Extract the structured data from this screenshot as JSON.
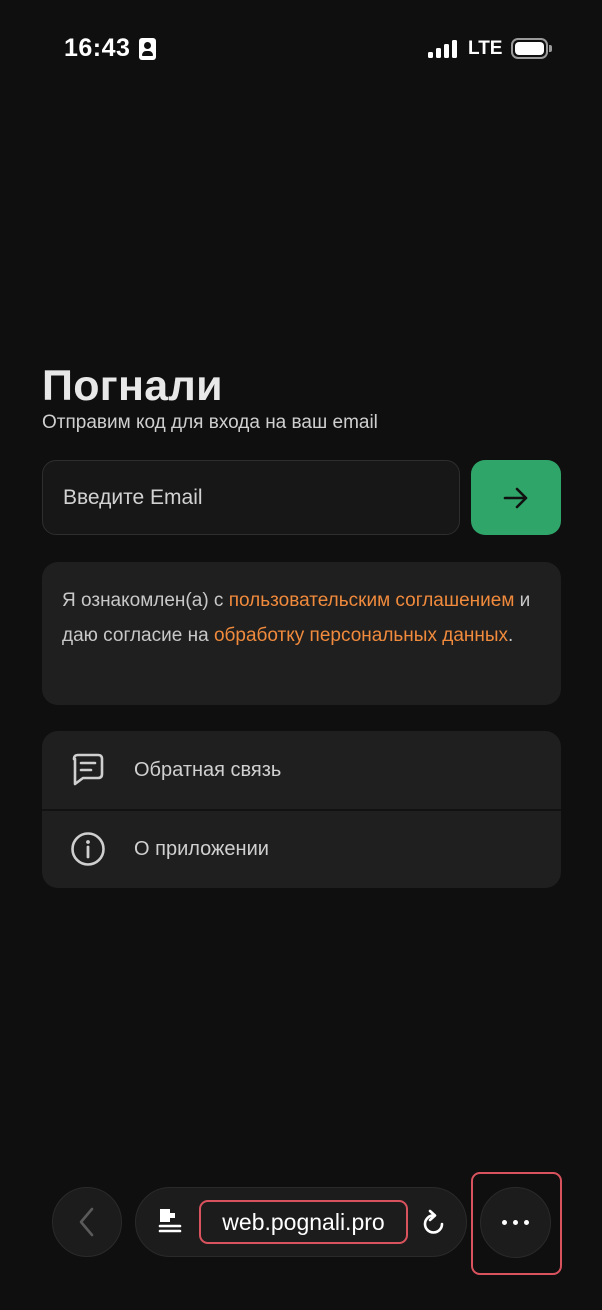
{
  "status_bar": {
    "time": "16:43",
    "network": "LTE",
    "icons": [
      "contact-card-icon",
      "signal-icon",
      "battery-icon"
    ]
  },
  "login": {
    "title": "Погнали",
    "subtitle": "Отправим код для входа на ваш email",
    "email_placeholder": "Введите Email",
    "submit_icon": "arrow-right-icon"
  },
  "consent": {
    "text_1": "Я ознакомлен(а) с ",
    "link_terms": "пользовательским соглашением",
    "text_2": " и даю согласие на ",
    "link_privacy": "обработку персональных данных",
    "text_3": "."
  },
  "menu": {
    "items": [
      {
        "label": "Обратная связь",
        "icon": "message-icon"
      },
      {
        "label": "О приложении",
        "icon": "info-icon"
      }
    ]
  },
  "browser": {
    "url": "web.pognali.pro",
    "icons": [
      "back-icon",
      "page-icon",
      "reload-icon",
      "more-icon"
    ]
  },
  "colors": {
    "background": "#0f0f0f",
    "card": "#1f1f1f",
    "accent_green": "#2fa56a",
    "link_orange": "#f08a3c",
    "highlight_red": "#d9535e"
  }
}
